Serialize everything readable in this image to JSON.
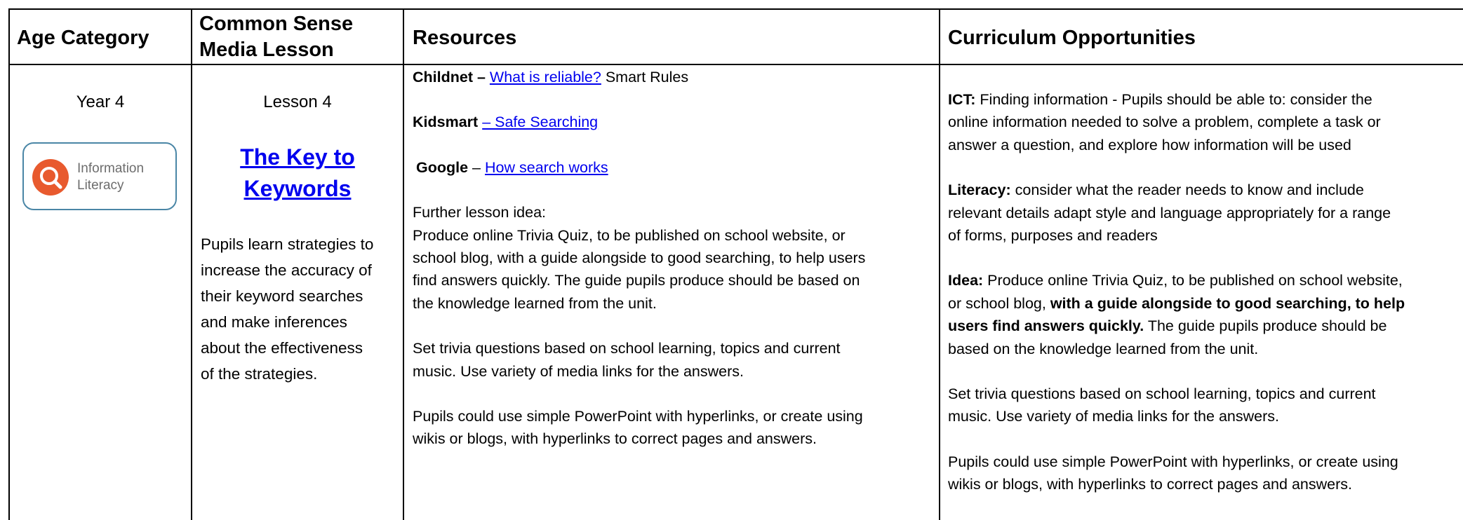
{
  "headers": {
    "age": "Age Category",
    "lesson_line1": "Common Sense",
    "lesson_line2": "Media Lesson",
    "resources": "Resources",
    "curriculum": "Curriculum Opportunities"
  },
  "age": {
    "year": "Year 4",
    "badge_line1": "Information",
    "badge_line2": "Literacy"
  },
  "lesson": {
    "number": "Lesson 4",
    "title_line1": "The Key to",
    "title_line2": "Keywords",
    "desc_lines": [
      "Pupils learn strategies to",
      "increase the accuracy of",
      "their keyword searches",
      "and make inferences",
      "about the effectiveness",
      "of the strategies."
    ]
  },
  "resources": {
    "childnet_label": "Childnet –",
    "childnet_link": "What is reliable?",
    "childnet_suffix": "Smart Rules",
    "kidsmart_label": "Kidsmart",
    "kidsmart_link": "– Safe Searching",
    "google_label": "Google",
    "google_dash": "–",
    "google_link": "How search works",
    "further_heading": "Further lesson idea:",
    "further_lines": [
      "Produce online Trivia Quiz, to be published on school website, or",
      "school blog, with a guide alongside to good searching, to help users",
      "find answers quickly. The guide pupils produce should be based on",
      "the knowledge learned from the unit."
    ],
    "trivia_lines": [
      "Set trivia questions based on school learning, topics and current",
      "music. Use variety of media links for the answers."
    ],
    "ppt_lines": [
      "Pupils could use simple PowerPoint with hyperlinks, or create using",
      "wikis or blogs, with hyperlinks to correct pages and answers."
    ]
  },
  "curriculum": {
    "ict_label": "ICT:",
    "ict_lines": [
      "Finding information - Pupils should be able to: consider the",
      "online information needed to solve a problem, complete a task or",
      "answer a question, and explore how information will be used"
    ],
    "lit_label": "Literacy:",
    "lit_lines": [
      "consider what the reader needs to know and include",
      "relevant details adapt style and language appropriately for a range",
      "of forms, purposes and readers"
    ],
    "idea_label": "Idea:",
    "idea_line1": "Produce online Trivia Quiz, to be published on school website,",
    "idea_line2_plain": "or school blog,",
    "idea_line2_bold": "with a guide alongside to good searching, to help",
    "idea_line3_bold": "users find answers quickly.",
    "idea_line3_plain": "The guide pupils produce should be",
    "idea_line4": "based on the knowledge learned from the unit.",
    "trivia_lines": [
      "Set trivia questions based on school learning, topics and current",
      "music. Use variety of media links for the answers."
    ],
    "ppt_lines": [
      "Pupils could use simple PowerPoint with hyperlinks, or create using",
      "wikis or blogs, with hyperlinks to correct pages and answers."
    ]
  }
}
